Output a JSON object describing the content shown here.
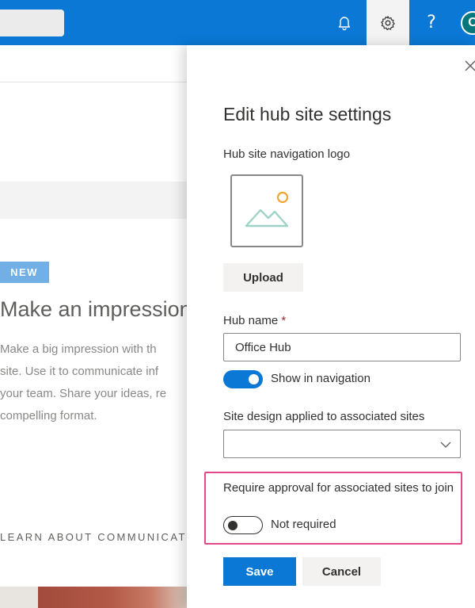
{
  "topbar": {
    "help_glyph": "?",
    "avatar_initial": "C",
    "bell_icon": "bell-icon",
    "gear_icon": "gear-icon"
  },
  "background_page": {
    "badge": "NEW",
    "heading": "Make an impression",
    "paragraph_lines": [
      "Make a big impression with th",
      "site. Use it to communicate inf",
      "your team. Share your ideas, re",
      "compelling format."
    ],
    "link": "LEARN ABOUT COMMUNICAT"
  },
  "panel": {
    "title": "Edit hub site settings",
    "logo_label": "Hub site navigation logo",
    "upload_label": "Upload",
    "hub_name_label": "Hub name",
    "required_marker": "*",
    "hub_name_value": "Office Hub",
    "show_in_nav_label": "Show in navigation",
    "show_in_nav_on": true,
    "site_design_label": "Site design applied to associated sites",
    "site_design_value": "",
    "approval_label": "Require approval for associated sites to join",
    "approval_status": "Not required",
    "approval_on": false,
    "save_label": "Save",
    "cancel_label": "Cancel"
  },
  "colors": {
    "brand": "#0a78d4",
    "highlight": "#e3488a",
    "logo_sun": "#f2a530",
    "logo_mountain": "#9fd3c7"
  }
}
